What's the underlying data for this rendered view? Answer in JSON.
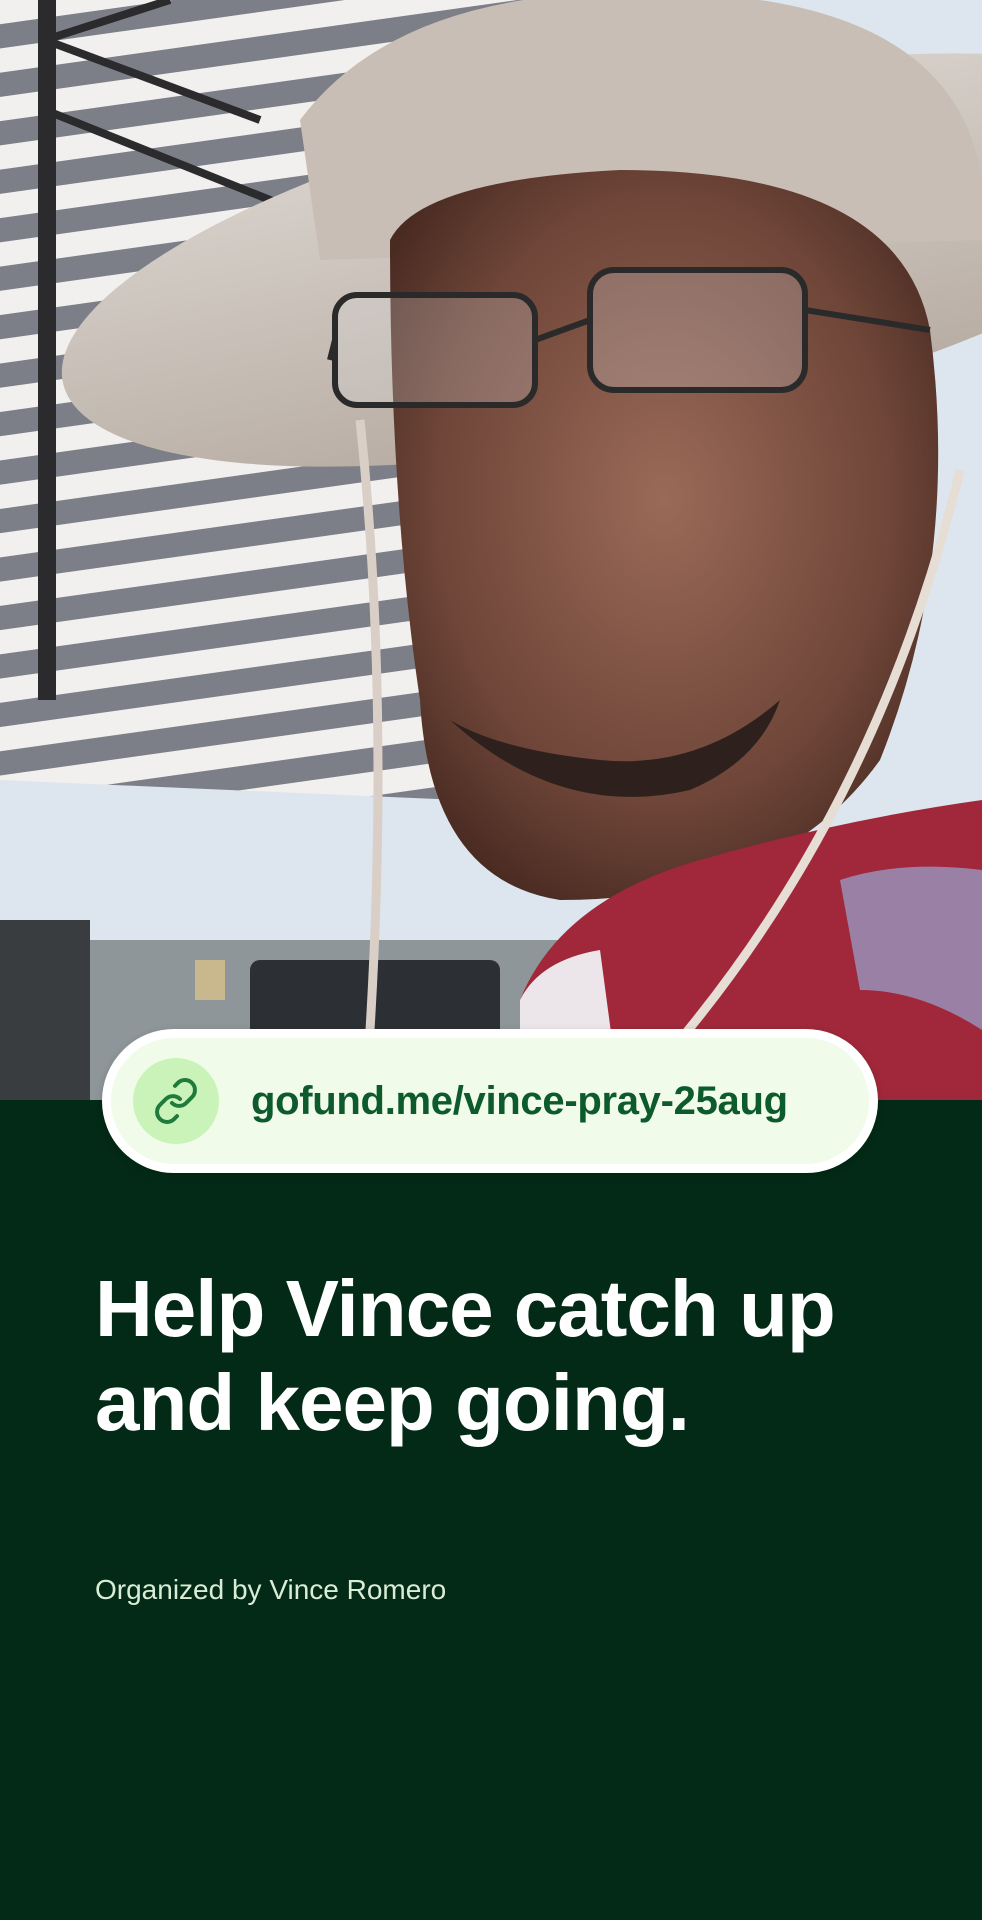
{
  "share_link": {
    "url": "gofund.me/vince-pray-25aug",
    "icon": "link-icon"
  },
  "campaign": {
    "title_line1": "Help Vince catch up",
    "title_line2": "and keep going.",
    "organizer": "Organized by Vince Romero"
  },
  "colors": {
    "background": "#032a16",
    "pill_background": "#f1fbe9",
    "icon_circle": "#c9f3b8",
    "link_text": "#0d5a2c",
    "title_text": "#ffffff"
  }
}
